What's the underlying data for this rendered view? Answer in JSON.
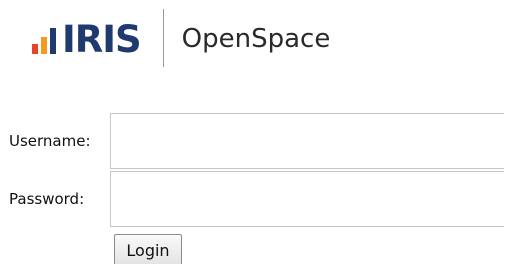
{
  "logo": {
    "wordmark": "IRIS",
    "product": "OpenSpace",
    "colors": {
      "bar1": "#e8432b",
      "bar2": "#f39a1f",
      "bar3": "#1f3b6e",
      "wordmark": "#1f3b6e"
    }
  },
  "form": {
    "username_label": "Username:",
    "username_value": "",
    "password_label": "Password:",
    "password_value": "",
    "login_label": "Login"
  }
}
